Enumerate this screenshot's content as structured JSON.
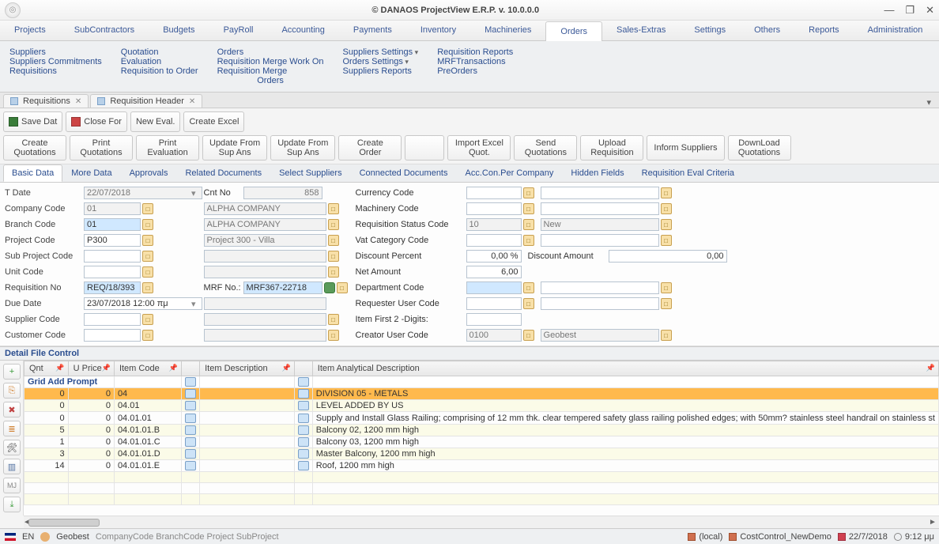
{
  "window": {
    "title": "© DANAOS ProjectView E.R.P. v. 10.0.0.0"
  },
  "mainmenu": [
    "Projects",
    "SubContractors",
    "Budgets",
    "PayRoll",
    "Accounting",
    "Payments",
    "Inventory",
    "Machineries",
    "Orders",
    "Sales-Extras",
    "Settings",
    "Others",
    "Reports",
    "Administration"
  ],
  "mainmenu_active": 8,
  "ribbon": {
    "c0": [
      "Suppliers",
      "Suppliers Commitments",
      "Requisitions"
    ],
    "c1": [
      "Quotation",
      "Evaluation",
      "Requisition to Order"
    ],
    "c2": [
      "Orders",
      "Requisition Merge Work On",
      "Requisition Merge",
      "Orders"
    ],
    "c3": [
      "Suppliers Settings",
      "Orders Settings",
      "Suppliers Reports"
    ],
    "c4": [
      "Requisition Reports",
      "MRFTransactions",
      "PreOrders"
    ]
  },
  "doctabs": [
    {
      "label": "Requisitions"
    },
    {
      "label": "Requisition Header"
    }
  ],
  "toolbar": {
    "save": "Save Dat",
    "close": "Close For",
    "neweval": "New Eval.",
    "createexcel": "Create Excel",
    "big": [
      "Create\nQuotations",
      "Print\nQuotations",
      "Print\nEvaluation",
      "Update From\nSup Ans",
      "Update From\nSup Ans",
      "Create\nOrder",
      "",
      "Import Excel\nQuot.",
      "Send\nQuotations",
      "Upload\nRequisition",
      "Inform Suppliers",
      "DownLoad\nQuotations"
    ]
  },
  "subtabs": [
    "Basic Data",
    "More Data",
    "Approvals",
    "Related Documents",
    "Select Suppliers",
    "Connected Documents",
    "Acc.Con.Per Company",
    "Hidden Fields",
    "Requisition Eval Criteria"
  ],
  "subtabs_active": 0,
  "form": {
    "left": [
      {
        "label": "T Date",
        "value": "22/07/2018",
        "type": "date-ro"
      },
      {
        "label": "Company Code",
        "value": "01",
        "type": "ro",
        "lookup": true
      },
      {
        "label": "Branch Code",
        "value": "01",
        "type": "hl",
        "lookup": true
      },
      {
        "label": "Project Code",
        "value": "P300",
        "type": "",
        "lookup": true
      },
      {
        "label": "Sub Project Code",
        "value": "",
        "type": "",
        "lookup": true
      },
      {
        "label": "Unit Code",
        "value": "",
        "type": "",
        "lookup": true
      },
      {
        "label": "Requisition No",
        "value": "REQ/18/393",
        "type": "hl",
        "lookup": true
      },
      {
        "label": "Due Date",
        "value": "23/07/2018 12:00 πμ",
        "type": "date"
      },
      {
        "label": "Supplier Code",
        "value": "",
        "type": "",
        "lookup": true
      },
      {
        "label": "Customer Code",
        "value": "",
        "type": "",
        "lookup": true
      }
    ],
    "mid": [
      {
        "label": "Cnt No",
        "value": "858",
        "type": "ro-num"
      },
      {
        "label": "",
        "value": "ALPHA COMPANY",
        "type": "ro",
        "lookup": true,
        "nolabel": true
      },
      {
        "label": "",
        "value": "ALPHA COMPANY",
        "type": "ro",
        "lookup": true,
        "nolabel": true
      },
      {
        "label": "",
        "value": "Project 300 - Villa",
        "type": "ro",
        "lookup": true,
        "nolabel": true
      },
      {
        "label": "",
        "value": "",
        "type": "ro",
        "lookup": true,
        "nolabel": true
      },
      {
        "label": "",
        "value": "",
        "type": "ro",
        "lookup": true,
        "nolabel": true
      },
      {
        "label": "MRF No.:",
        "value": "MRF367-22718",
        "type": "hl",
        "lookup": true,
        "green": true
      },
      {
        "label": "",
        "value": "",
        "type": "ro",
        "nolabel": true
      },
      {
        "label": "",
        "value": "",
        "type": "ro",
        "lookup": true,
        "nolabel": true
      },
      {
        "label": "",
        "value": "",
        "type": "ro",
        "lookup": true,
        "nolabel": true
      }
    ],
    "r1": [
      {
        "label": "Currency Code",
        "value": "",
        "value2": "",
        "lookup1": true,
        "lookup2": true
      },
      {
        "label": "Machinery Code",
        "value": "",
        "value2": "",
        "lookup1": true,
        "lookup2": true
      },
      {
        "label": "Requisition Status Code",
        "value": "10",
        "value2": "New",
        "ro": true,
        "lookup1": true,
        "lookup2": true
      },
      {
        "label": "Vat Category Code",
        "value": "",
        "value2": "",
        "lookup1": true,
        "lookup2": true
      },
      {
        "label": "Discount Percent",
        "value": "0,00 %",
        "label2": "Discount Amount",
        "value2": "0,00",
        "num": true
      },
      {
        "label": "Net Amount",
        "value": "6,00",
        "value2": null,
        "num": true
      },
      {
        "label": "Department Code",
        "value": "",
        "value2": "",
        "hl": true,
        "lookup1": true,
        "lookup2": true
      },
      {
        "label": "Requester User Code",
        "value": "",
        "value2": "",
        "lookup1": true,
        "lookup2": true
      },
      {
        "label": "Item First 2 -Digits:",
        "value": "",
        "value2": null
      },
      {
        "label": "Creator User Code",
        "value": "0100",
        "value2": "Geobest",
        "ro": true,
        "lookup1": true,
        "lookup2": true
      }
    ]
  },
  "dfc": "Detail File Control",
  "grid": {
    "cols": [
      "Qnt",
      "U Price",
      "Item Code",
      "",
      "Item Description",
      "",
      "Item Analytical Description"
    ],
    "prompt": "Grid Add Prompt",
    "rows": [
      {
        "qnt": "0",
        "uprice": "0",
        "code": "04",
        "desc": "",
        "an": "DIVISION 05 - METALS",
        "sel": true
      },
      {
        "qnt": "0",
        "uprice": "0",
        "code": "04.01",
        "desc": "",
        "an": "LEVEL ADDED BY US"
      },
      {
        "qnt": "0",
        "uprice": "0",
        "code": "04.01.01",
        "desc": "",
        "an": "Supply and Install Glass Railing; comprising of 12 mm thk. clear tempered safety glass railing polished edges; with 50mm? stainless steel handrail on stainless st"
      },
      {
        "qnt": "5",
        "uprice": "0",
        "code": "04.01.01.B",
        "desc": "",
        "an": "Balcony 02, 1200 mm high"
      },
      {
        "qnt": "1",
        "uprice": "0",
        "code": "04.01.01.C",
        "desc": "",
        "an": "Balcony 03, 1200 mm high"
      },
      {
        "qnt": "3",
        "uprice": "0",
        "code": "04.01.01.D",
        "desc": "",
        "an": "Master Balcony, 1200 mm high"
      },
      {
        "qnt": "14",
        "uprice": "0",
        "code": "04.01.01.E",
        "desc": "",
        "an": "Roof, 1200 mm high"
      }
    ]
  },
  "status": {
    "lang": "EN",
    "user": "Geobest",
    "crumbs": "CompanyCode  BranchCode  Project  SubProject",
    "server": "(local)",
    "db": "CostControl_NewDemo",
    "date": "22/7/2018",
    "time": "9:12 μμ"
  },
  "sidetool_labels": {
    "add": "+",
    "ins": "⎘",
    "del": "✖",
    "dup": "≣",
    "tool": "🛠",
    "col": "▥",
    "mj": "MJ",
    "exp": "⤓"
  }
}
